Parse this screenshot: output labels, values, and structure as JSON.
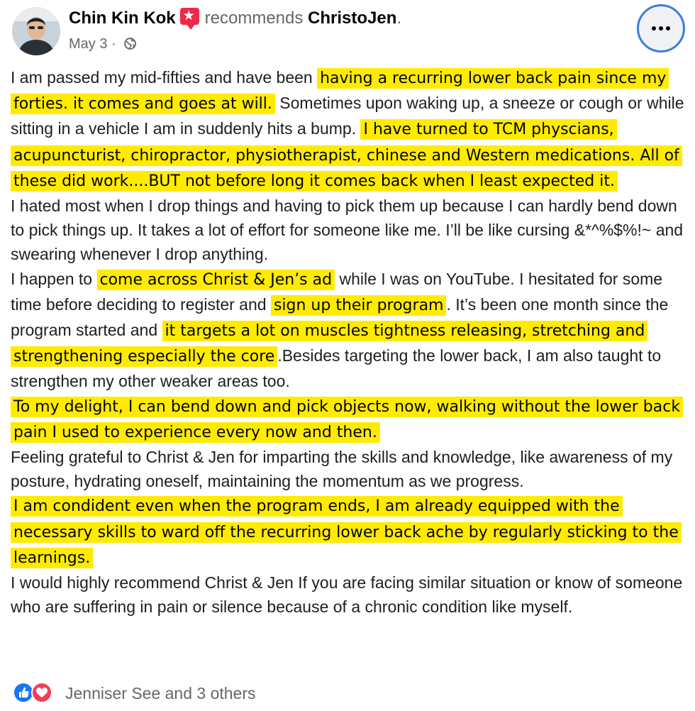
{
  "post": {
    "author_name": "Chin Kin Kok",
    "recommends_text": "recommends",
    "page_name": "ChristoJen",
    "page_name_suffix": ".",
    "date": "May 3",
    "separator": "·",
    "paragraphs": [
      [
        {
          "text": "I am passed my mid-fifties and have been ",
          "highlight": false
        },
        {
          "text": "having a recurring lower back pain since my forties. it comes and goes at will.",
          "highlight": true
        },
        {
          "text": " Sometimes upon waking up, a sneeze or cough or while sitting in a vehicle I am in suddenly hits a bump. ",
          "highlight": false
        },
        {
          "text": "I have turned to TCM physcians, acupuncturist, chiropractor, physiotherapist, chinese and Western medications. All of these did work....BUT not before long it comes back when I least expected it.",
          "highlight": true
        }
      ],
      [
        {
          "text": "I hated most when I drop things and having to pick them up because I can hardly bend down to pick things up. It takes a lot of effort for someone like me. I’ll be like cursing &*^%$%!~  and swearing whenever I drop anything.",
          "highlight": false
        }
      ],
      [
        {
          "text": "I happen to ",
          "highlight": false
        },
        {
          "text": "come across Christ & Jen’s ad",
          "highlight": true
        },
        {
          "text": " while I was on YouTube. I hesitated for some time before deciding to register and ",
          "highlight": false
        },
        {
          "text": "sign up their program",
          "highlight": true
        },
        {
          "text": ". It’s been one month since the program started and ",
          "highlight": false
        },
        {
          "text": "it targets a lot on muscles tightness releasing, stretching and strengthening especially the core",
          "highlight": true
        },
        {
          "text": ".Besides targeting the lower back, I am also taught to strengthen my other weaker areas too.",
          "highlight": false
        }
      ],
      [
        {
          "text": "To my delight, I can bend down and pick objects now, walking without the lower back pain I used to experience every now and then.",
          "highlight": true
        }
      ],
      [
        {
          "text": "Feeling grateful to Christ & Jen for imparting the skills and knowledge, like awareness of my posture, hydrating oneself, maintaining the momentum as we progress.",
          "highlight": false
        }
      ],
      [
        {
          "text": "I am condident even when the program ends, I am already equipped with the necessary skills to ward off the recurring lower back ache by regularly sticking to the learnings.",
          "highlight": true
        }
      ],
      [
        {
          "text": "I would highly recommend Christ & Jen If you are facing similar situation or know of someone who are suffering in pain or silence because of a chronic condition like myself.",
          "highlight": false
        }
      ]
    ]
  },
  "reactions": {
    "icons": [
      "like-icon",
      "love-icon"
    ],
    "text": "Jenniser See and 3 others"
  },
  "colors": {
    "highlight": "#ffeb00",
    "secondary_text": "#65676b",
    "like_blue": "#1877f2",
    "love_red": "#f33e58",
    "recommend_red": "#f02849"
  }
}
